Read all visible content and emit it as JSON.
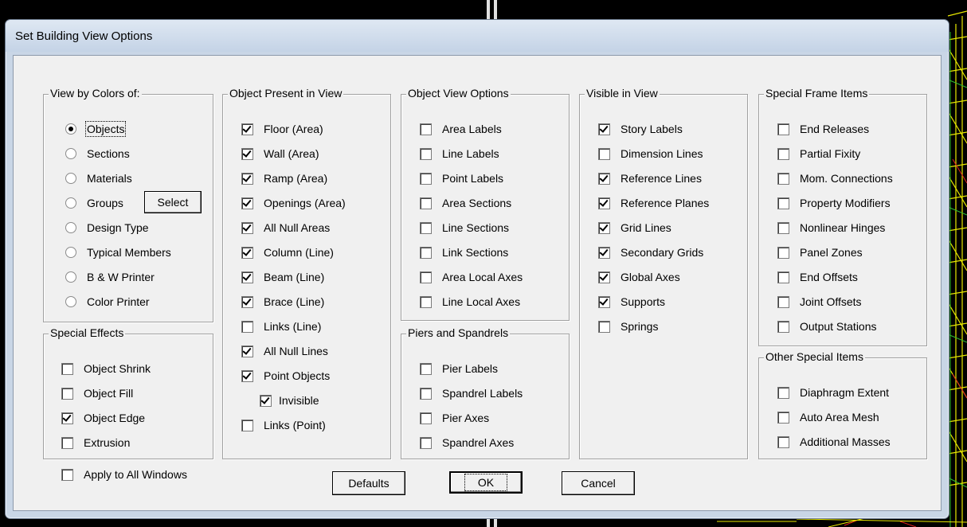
{
  "dialog": {
    "title": "Set Building View Options"
  },
  "view_by_colors": {
    "title": "View by Colors of:",
    "options": [
      {
        "label": "Objects",
        "selected": true
      },
      {
        "label": "Sections",
        "selected": false
      },
      {
        "label": "Materials",
        "selected": false
      },
      {
        "label": "Groups",
        "selected": false
      },
      {
        "label": "Design Type",
        "selected": false
      },
      {
        "label": "Typical Members",
        "selected": false
      },
      {
        "label": "B & W Printer",
        "selected": false
      },
      {
        "label": "Color Printer",
        "selected": false
      }
    ],
    "select_button": "Select"
  },
  "special_effects": {
    "title": "Special Effects",
    "items": [
      {
        "label": "Object Shrink",
        "checked": false
      },
      {
        "label": "Object Fill",
        "checked": false
      },
      {
        "label": "Object Edge",
        "checked": true
      },
      {
        "label": "Extrusion",
        "checked": false
      }
    ]
  },
  "object_present": {
    "title": "Object Present in View",
    "items": [
      {
        "label": "Floor (Area)",
        "checked": true
      },
      {
        "label": "Wall (Area)",
        "checked": true
      },
      {
        "label": "Ramp (Area)",
        "checked": true
      },
      {
        "label": "Openings (Area)",
        "checked": true
      },
      {
        "label": "All Null Areas",
        "checked": true
      },
      {
        "label": "Column (Line)",
        "checked": true
      },
      {
        "label": "Beam (Line)",
        "checked": true
      },
      {
        "label": "Brace (Line)",
        "checked": true
      },
      {
        "label": "Links (Line)",
        "checked": false
      },
      {
        "label": "All Null Lines",
        "checked": true
      },
      {
        "label": "Point Objects",
        "checked": true
      },
      {
        "label": "Invisible",
        "checked": true
      },
      {
        "label": "Links (Point)",
        "checked": false
      }
    ]
  },
  "object_view_options": {
    "title": "Object View Options",
    "items": [
      {
        "label": "Area Labels",
        "checked": false
      },
      {
        "label": "Line Labels",
        "checked": false
      },
      {
        "label": "Point Labels",
        "checked": false
      },
      {
        "label": "Area Sections",
        "checked": false
      },
      {
        "label": "Line Sections",
        "checked": false
      },
      {
        "label": "Link Sections",
        "checked": false
      },
      {
        "label": "Area Local Axes",
        "checked": false
      },
      {
        "label": "Line Local Axes",
        "checked": false
      }
    ]
  },
  "piers_spandrels": {
    "title": "Piers and Spandrels",
    "items": [
      {
        "label": "Pier Labels",
        "checked": false
      },
      {
        "label": "Spandrel Labels",
        "checked": false
      },
      {
        "label": "Pier Axes",
        "checked": false
      },
      {
        "label": "Spandrel Axes",
        "checked": false
      }
    ]
  },
  "visible_in_view": {
    "title": "Visible in View",
    "items": [
      {
        "label": "Story Labels",
        "checked": true
      },
      {
        "label": "Dimension Lines",
        "checked": false
      },
      {
        "label": "Reference Lines",
        "checked": true
      },
      {
        "label": "Reference Planes",
        "checked": true
      },
      {
        "label": "Grid Lines",
        "checked": true
      },
      {
        "label": "Secondary Grids",
        "checked": true
      },
      {
        "label": "Global Axes",
        "checked": true
      },
      {
        "label": "Supports",
        "checked": true
      },
      {
        "label": "Springs",
        "checked": false
      }
    ]
  },
  "special_frame_items": {
    "title": "Special Frame Items",
    "items": [
      {
        "label": "End Releases",
        "checked": false
      },
      {
        "label": "Partial Fixity",
        "checked": false
      },
      {
        "label": "Mom. Connections",
        "checked": false
      },
      {
        "label": "Property Modifiers",
        "checked": false
      },
      {
        "label": "Nonlinear Hinges",
        "checked": false
      },
      {
        "label": "Panel Zones",
        "checked": false
      },
      {
        "label": "End Offsets",
        "checked": false
      },
      {
        "label": "Joint Offsets",
        "checked": false
      },
      {
        "label": "Output Stations",
        "checked": false
      }
    ]
  },
  "other_special_items": {
    "title": "Other Special Items",
    "items": [
      {
        "label": "Diaphragm Extent",
        "checked": false
      },
      {
        "label": "Auto Area Mesh",
        "checked": false
      },
      {
        "label": "Additional Masses",
        "checked": false
      }
    ]
  },
  "apply_all": {
    "label": "Apply to All Windows",
    "checked": false
  },
  "buttons": {
    "defaults": "Defaults",
    "ok": "OK",
    "cancel": "Cancel"
  },
  "colors": {
    "dialog_frame": "#c9d6e6",
    "client": "#f0f0f0",
    "scene_yellow": "#e8e800",
    "scene_green": "#30c030",
    "scene_red": "#e02020"
  }
}
